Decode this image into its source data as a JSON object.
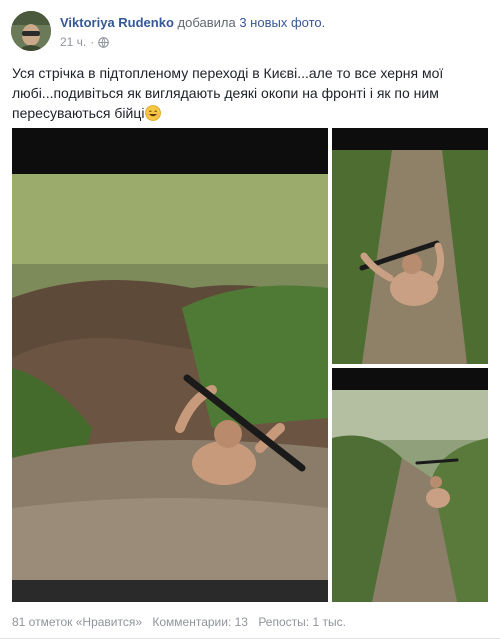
{
  "post": {
    "author": "Viktoriya Rudenko",
    "action_prefix": "добавила",
    "action_link": "3 новых фото.",
    "time": "21 ч.",
    "text_main": "Уся стрічка в підтопленому переході в Києві...але то все херня мої любі...подивіться як виглядають деякі окопи на фронті і як по ним пересуваються бійці",
    "emoji": "smiling-face-icon"
  },
  "photos": [
    {
      "name": "photo-1"
    },
    {
      "name": "photo-2"
    },
    {
      "name": "photo-3"
    }
  ],
  "stats": {
    "likes": "81 отметок «Нравится»",
    "comments": "Комментарии: 13",
    "shares": "Репосты: 1 тыс."
  },
  "colors": {
    "link": "#365899",
    "meta": "#90949c",
    "text": "#1d2129"
  }
}
